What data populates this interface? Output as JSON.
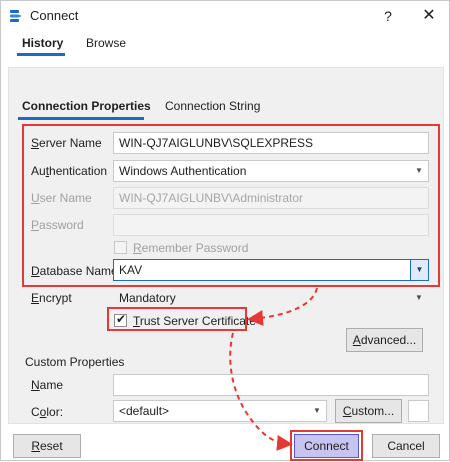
{
  "window": {
    "title": "Connect",
    "help_label": "?",
    "close_label": "✕"
  },
  "top_tabs": {
    "history": "History",
    "browse": "Browse"
  },
  "sub_tabs": {
    "connection_properties": "Connection Properties",
    "connection_string": "Connection String"
  },
  "form": {
    "server_name": {
      "label_u": "S",
      "label_rest": "erver Name",
      "value": "WIN-QJ7AIGLUNBV\\SQLEXPRESS"
    },
    "authentication": {
      "label_pre": "Au",
      "label_u": "t",
      "label_rest": "hentication",
      "value": "Windows Authentication"
    },
    "user_name": {
      "label_u": "U",
      "label_rest": "ser Name",
      "value": "WIN-QJ7AIGLUNBV\\Administrator"
    },
    "password": {
      "label_u": "P",
      "label_rest": "assword",
      "value": ""
    },
    "remember_password": {
      "label_u": "R",
      "label_rest": "emember Password",
      "checked": false
    },
    "database_name": {
      "label_u": "D",
      "label_rest": "atabase Name",
      "value": "KAV"
    },
    "encrypt": {
      "label_u": "E",
      "label_rest": "ncrypt",
      "value": "Mandatory"
    },
    "trust_server_certificate": {
      "label_u": "T",
      "label_rest": "rust Server Certificate",
      "checked": true
    },
    "advanced_button": {
      "label_u": "A",
      "label_rest": "dvanced..."
    }
  },
  "custom_properties": {
    "heading": "Custom Properties",
    "name": {
      "label_u": "N",
      "label_rest": "ame",
      "value": ""
    },
    "color": {
      "label_pre": "C",
      "label_u": "o",
      "label_rest": "lor:",
      "value": "<default>"
    },
    "custom_button": {
      "label_u": "C",
      "label_rest": "ustom..."
    }
  },
  "footer": {
    "reset": {
      "label_u": "R",
      "label_rest": "eset"
    },
    "connect": "Connect",
    "cancel": "Cancel"
  },
  "colors": {
    "accent": "#1b6ac9",
    "annotation_red": "#e53935",
    "connect_fill": "#c7c4f2"
  },
  "icons": {
    "app": "database-connect-icon",
    "dropdown": "chevron-down-icon",
    "check": "check-icon"
  }
}
